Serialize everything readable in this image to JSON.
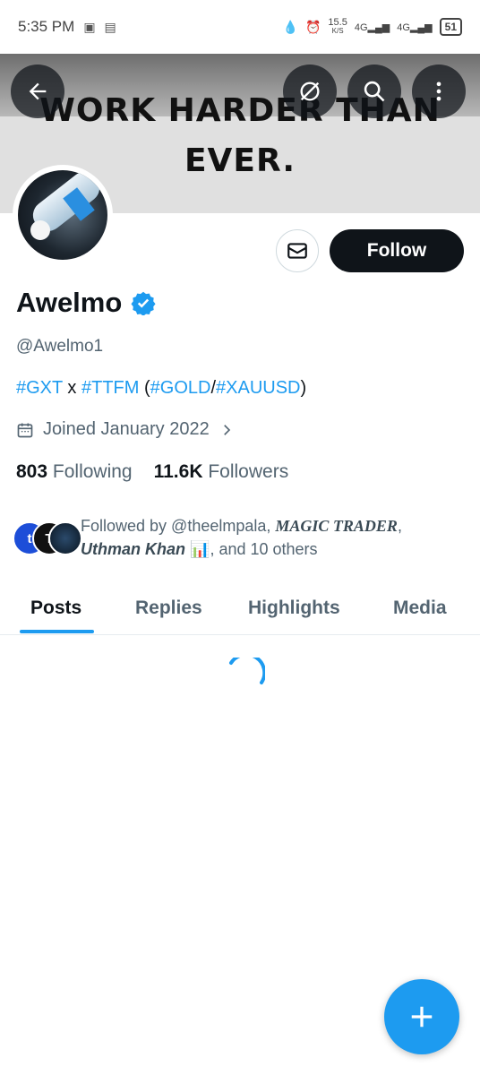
{
  "status_bar": {
    "time": "5:35 PM",
    "network_speed": "15.5",
    "network_unit": "K/S",
    "signal_1": "4G",
    "signal_2": "4G",
    "battery": "51"
  },
  "banner": {
    "line1": "WORK HARDER THAN",
    "line2": "EVER."
  },
  "profile": {
    "name": "Awelmo",
    "handle": "@Awelmo1",
    "bio": {
      "tag1": "#GXT",
      "x": " x ",
      "tag2": "#TTFM",
      "open": " (",
      "tag3": "#GOLD",
      "slash": "/",
      "tag4": "#XAUUSD",
      "close": ")"
    },
    "joined": "Joined January 2022",
    "following_count": "803",
    "following_label": "Following",
    "followers_count": "11.6K",
    "followers_label": "Followers"
  },
  "followed_by": {
    "prefix": "Followed by @theelmpala, ",
    "user2": "MAGIC TRADER",
    "comma": ",",
    "user3": "Uthman Khan",
    "chart_emoji": "📊",
    "suffix": ", and 10 others",
    "avatar1_letter": "t",
    "avatar2_letter": "T"
  },
  "actions": {
    "follow_label": "Follow"
  },
  "tabs": [
    {
      "label": "Posts"
    },
    {
      "label": "Replies"
    },
    {
      "label": "Highlights"
    },
    {
      "label": "Media"
    }
  ],
  "colors": {
    "accent": "#1d9bf0",
    "text_primary": "#0f1419",
    "text_secondary": "#536471"
  }
}
